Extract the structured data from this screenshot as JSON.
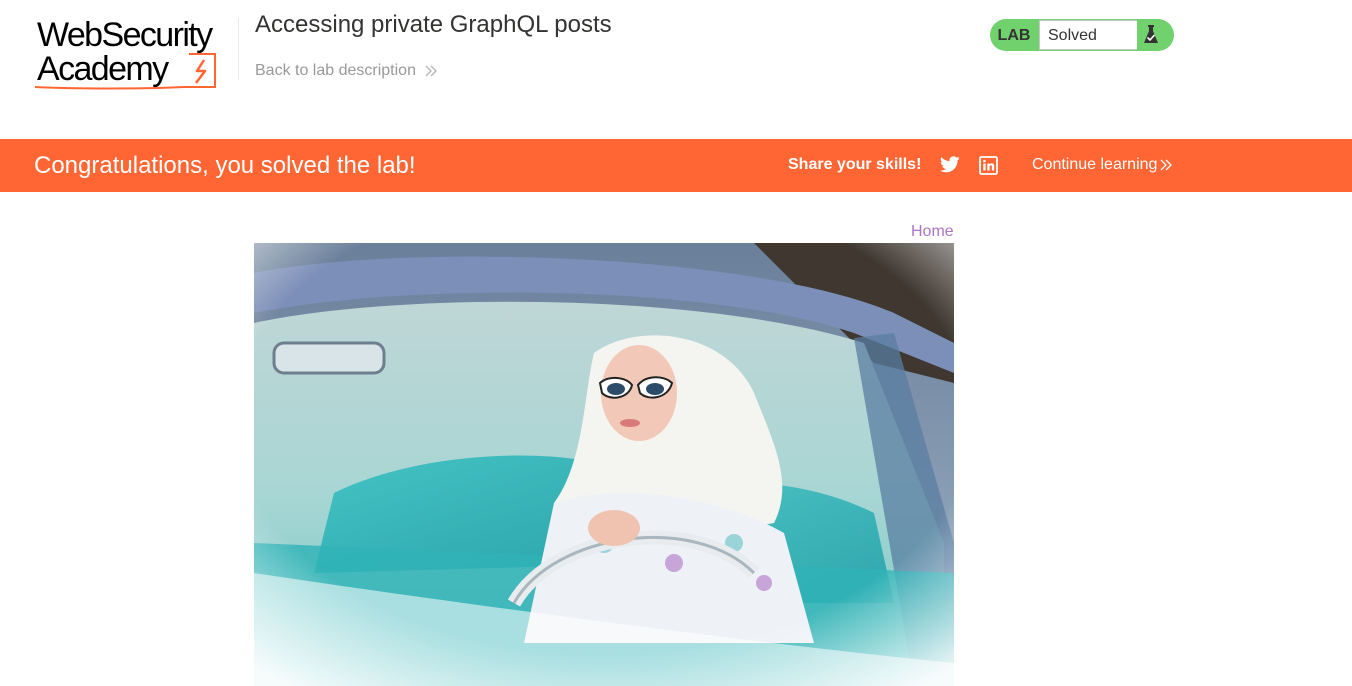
{
  "header": {
    "logo_line1": "WebSecurity",
    "logo_line2": "Academy",
    "lab_title": "Accessing private GraphQL posts",
    "back_link_label": "Back to lab description",
    "lab_tag": "LAB",
    "lab_status": "Solved"
  },
  "banner": {
    "message": "Congratulations, you solved the lab!",
    "share_label": "Share your skills!",
    "continue_label": "Continue learning"
  },
  "nav": {
    "home_label": "Home"
  },
  "colors": {
    "banner": "#ff6633",
    "solved_badge": "#70d16d",
    "link": "#ae75c5"
  },
  "icons": [
    "logo-bolt-icon",
    "double-chevron-right-icon",
    "flask-icon",
    "twitter-icon",
    "linkedin-icon"
  ]
}
